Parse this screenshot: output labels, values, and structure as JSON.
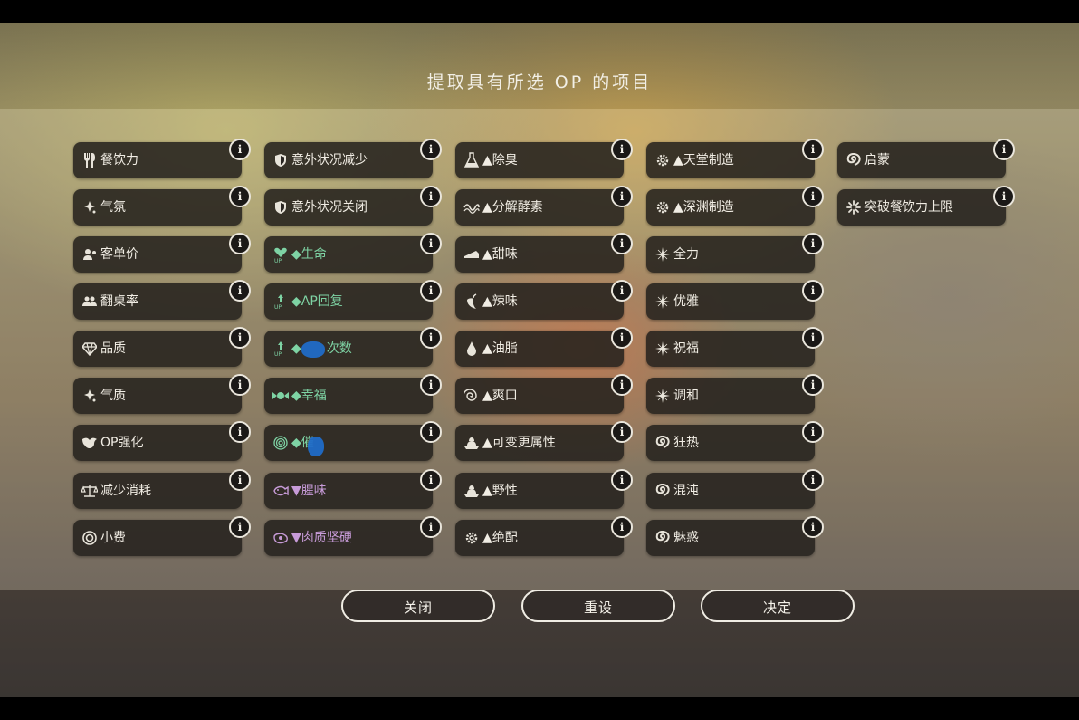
{
  "dialog": {
    "title": "提取具有所选 OP 的项目",
    "info_glyph": "i"
  },
  "columns": [
    [
      {
        "label": "餐饮力",
        "icon": "fork-knife-icon",
        "style": "normal"
      },
      {
        "label": "气氛",
        "icon": "sparkle-icon",
        "style": "normal"
      },
      {
        "label": "客单价",
        "icon": "customer-icon",
        "style": "normal"
      },
      {
        "label": "翻桌率",
        "icon": "group-icon",
        "style": "normal"
      },
      {
        "label": "品质",
        "icon": "diamond-icon",
        "style": "normal"
      },
      {
        "label": "气质",
        "icon": "sparkle-icon",
        "style": "normal"
      },
      {
        "label": "OP强化",
        "icon": "dragon-icon",
        "style": "normal"
      },
      {
        "label": "减少消耗",
        "icon": "scale-icon",
        "style": "normal"
      },
      {
        "label": "小费",
        "icon": "coin-icon",
        "style": "normal"
      }
    ],
    [
      {
        "label": "意外状况减少",
        "icon": "shield-icon",
        "style": "normal"
      },
      {
        "label": "意外状况关闭",
        "icon": "shield-icon",
        "style": "normal"
      },
      {
        "label": "◆生命",
        "icon": "heart-up-icon",
        "style": "positive"
      },
      {
        "label": "◆AP回复",
        "icon": "ap-up-icon",
        "style": "positive"
      },
      {
        "label": "◆",
        "label_tail": "次数",
        "icon": "ap-up-icon",
        "style": "positive"
      },
      {
        "label": "◆幸福",
        "icon": "candy-icon",
        "style": "positive"
      },
      {
        "label": "◆催",
        "icon": "spiral-icon",
        "style": "positive"
      },
      {
        "label": "▼腥味",
        "icon": "fish-icon",
        "style": "negative"
      },
      {
        "label": "▼肉质坚硬",
        "icon": "meat-icon",
        "style": "negative"
      }
    ],
    [
      {
        "label": "▲除臭",
        "icon": "flask-icon",
        "style": "normal"
      },
      {
        "label": "▲分解酵素",
        "icon": "enzyme-icon",
        "style": "normal"
      },
      {
        "label": "▲甜味",
        "icon": "cake-icon",
        "style": "normal"
      },
      {
        "label": "▲辣味",
        "icon": "pepper-icon",
        "style": "normal"
      },
      {
        "label": "▲油脂",
        "icon": "drop-icon",
        "style": "normal"
      },
      {
        "label": "▲爽口",
        "icon": "swirl-icon",
        "style": "normal"
      },
      {
        "label": "▲可变更属性",
        "icon": "dish-icon",
        "style": "normal"
      },
      {
        "label": "▲野性",
        "icon": "dish-icon",
        "style": "normal"
      },
      {
        "label": "▲绝配",
        "icon": "gear-icon",
        "style": "normal"
      }
    ],
    [
      {
        "label": "▲天堂制造",
        "icon": "gear-icon",
        "style": "normal"
      },
      {
        "label": "▲深渊制造",
        "icon": "gear-icon",
        "style": "normal"
      },
      {
        "label": "全力",
        "icon": "star-burst-icon",
        "style": "normal"
      },
      {
        "label": "优雅",
        "icon": "star-burst-icon",
        "style": "normal"
      },
      {
        "label": "祝福",
        "icon": "star-burst-icon",
        "style": "normal"
      },
      {
        "label": "调和",
        "icon": "star-burst-icon",
        "style": "normal"
      },
      {
        "label": "狂热",
        "icon": "vortex-icon",
        "style": "normal"
      },
      {
        "label": "混沌",
        "icon": "vortex-icon",
        "style": "normal"
      },
      {
        "label": "魅惑",
        "icon": "vortex-icon",
        "style": "normal"
      }
    ],
    [
      {
        "label": "启蒙",
        "icon": "vortex-icon",
        "style": "normal"
      },
      {
        "label": "突破餐饮力上限",
        "icon": "burst-icon",
        "style": "normal"
      }
    ]
  ],
  "buttons": {
    "close": "关闭",
    "reset": "重设",
    "confirm": "决定"
  },
  "colors": {
    "positive": "#7ed3a4",
    "negative": "#c79bd8",
    "normal": "#f1ede4",
    "scribble": "#1f6fd0"
  }
}
